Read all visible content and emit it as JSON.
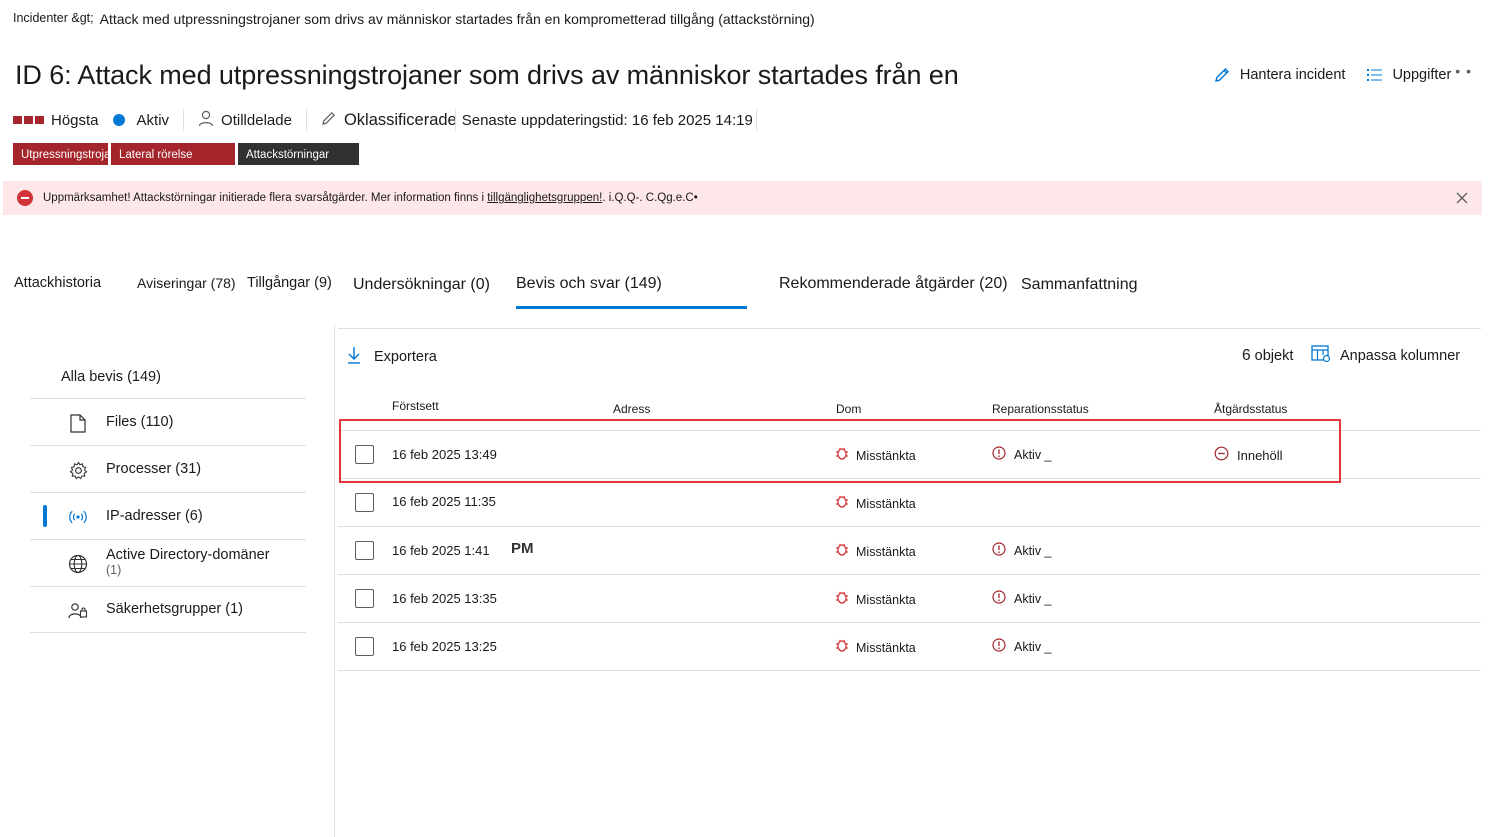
{
  "breadcrumb": {
    "root": "Incidenter &gt;",
    "current": "Attack med utpressningstrojaner som drivs av människor startades från en komprometterad tillgång (attackstörning)"
  },
  "page_title": "ID 6: Attack med utpressningstrojaner som drivs av människor startades från en",
  "header_actions": {
    "manage": "Hantera incident",
    "tasks": "Uppgifter",
    "more": "• •"
  },
  "meta": {
    "severity": "Högsta",
    "status": "Aktiv",
    "assigned": "Otilldelade",
    "classification": "Oklassificerade",
    "last_update": "Senaste uppdateringstid: 16 feb 2025 14:19"
  },
  "tags": [
    "Utpressningstrojan",
    "Lateral rörelse",
    "Attackstörningar"
  ],
  "alert": {
    "text": "Uppmärksamhet! Attackstörningar initierade flera svarsåtgärder. Mer information finns i ",
    "link": "tillgänglighetsgruppen!",
    "tail": ". i.Q.Q-. C.Qg.e.C•"
  },
  "tabs": [
    "Attackhistoria",
    "Aviseringar (78)",
    "Tillgångar (9)",
    "Undersökningar (0)",
    "Bevis och svar (149)",
    "Rekommenderade åtgärder (20)",
    "Sammanfattning"
  ],
  "left_nav": {
    "all": "Alla bevis (149)",
    "items": [
      {
        "label": "Files (110)",
        "icon": "file-icon"
      },
      {
        "label": "Processer (31)",
        "icon": "gear-icon"
      },
      {
        "label": "IP-adresser (6)",
        "icon": "broadcast-icon"
      },
      {
        "label": "Active Directory-domäner",
        "sub": "(1)",
        "icon": "globe-icon"
      },
      {
        "label": "Säkerhetsgrupper (1)",
        "icon": "group-icon"
      }
    ]
  },
  "toolbar": {
    "export": "Exportera",
    "count_num": "6",
    "count_label": "objekt",
    "customize": "Anpassa kolumner"
  },
  "columns": [
    "Förstsett",
    "Adress",
    "Dom",
    "Reparationsstatus",
    "Åtgärdsstatus"
  ],
  "rows": [
    {
      "first_seen": "16 feb 2025 13:49",
      "extra": "",
      "verdict": "Misstänkta",
      "remediation": "Aktiv _",
      "action": "Innehöll"
    },
    {
      "first_seen": "16 feb 2025 11:35",
      "extra": "",
      "verdict": "Misstänkta",
      "remediation": "",
      "action": ""
    },
    {
      "first_seen": "16 feb 2025 1:41",
      "extra": "PM",
      "verdict": "Misstänkta",
      "remediation": "Aktiv _",
      "action": ""
    },
    {
      "first_seen": "16 feb 2025 13:35",
      "extra": "",
      "verdict": "Misstänkta",
      "remediation": "Aktiv _",
      "action": ""
    },
    {
      "first_seen": "16 feb 2025 13:25",
      "extra": "",
      "verdict": "Misstänkta",
      "remediation": "Aktiv _",
      "action": ""
    }
  ],
  "colors": {
    "accent": "#0078d4",
    "severity": "#a4262c",
    "alert_bg": "#fde7e9",
    "highlight": "#e03a3e"
  }
}
